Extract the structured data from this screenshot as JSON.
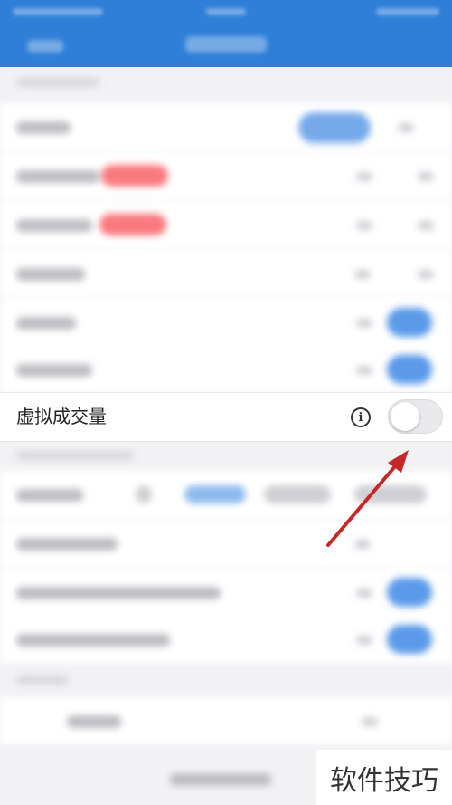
{
  "focus_setting": {
    "label": "虚拟成交量",
    "toggle_state": "off"
  },
  "watermark": {
    "text": "软件技巧"
  },
  "icons": {
    "info": "info-icon",
    "arrow": "red-arrow-annotation"
  },
  "colors": {
    "header": "#2f7fd8",
    "arrow": "#c62828",
    "toggle_on": "#5b9ae9",
    "badge": "#f9797e"
  }
}
